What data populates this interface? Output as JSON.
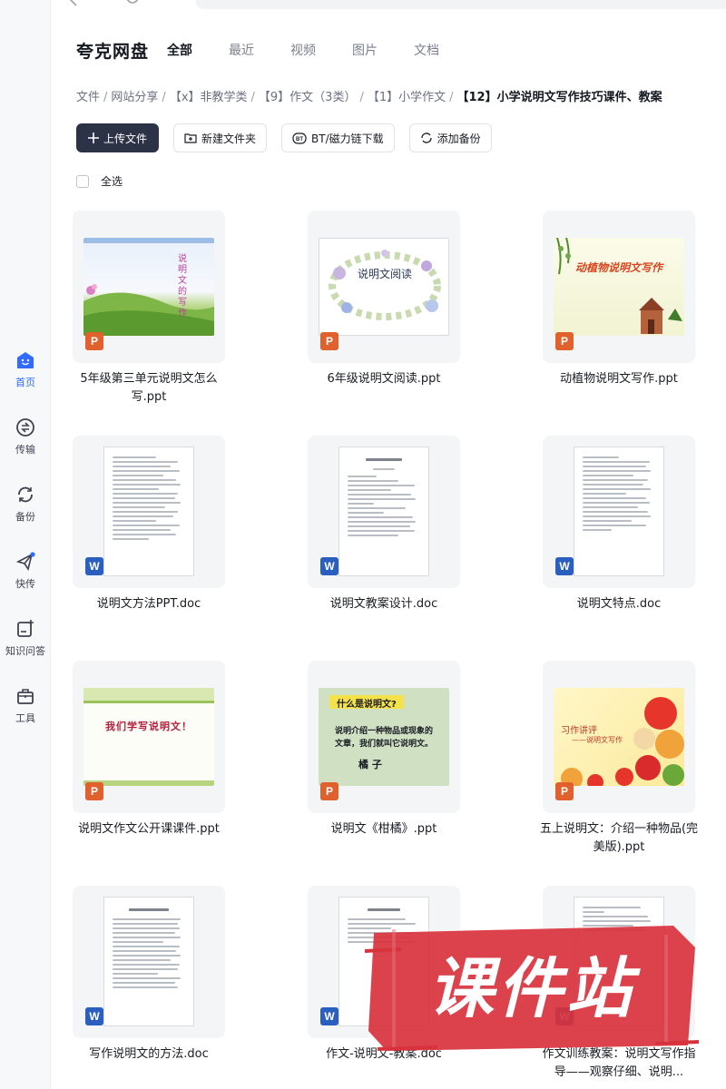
{
  "sidebar": {
    "items": [
      {
        "label": "首页",
        "icon": "home-icon",
        "active": true
      },
      {
        "label": "传输",
        "icon": "transfer-icon",
        "active": false
      },
      {
        "label": "备份",
        "icon": "backup-icon",
        "active": false
      },
      {
        "label": "快传",
        "icon": "quick-send-icon",
        "active": false
      },
      {
        "label": "知识问答",
        "icon": "qa-icon",
        "active": false
      },
      {
        "label": "工具",
        "icon": "toolbox-icon",
        "active": false
      }
    ]
  },
  "header": {
    "brand": "夸克网盘",
    "tabs": [
      "全部",
      "最近",
      "视频",
      "图片",
      "文档"
    ],
    "active_tab": "全部"
  },
  "breadcrumb": [
    "文件",
    "网站分享",
    "【x】非教学类",
    "【9】作文（3类）",
    "【1】小学作文",
    "【12】小学说明文写作技巧课件、教案"
  ],
  "toolbar": {
    "upload": "上传文件",
    "new_folder": "新建文件夹",
    "bt_download": "BT/磁力链下载",
    "add_backup": "添加备份"
  },
  "select_all": "全选",
  "files": [
    {
      "name": "5年级第三单元说明文怎么写.ppt",
      "type": "ppt",
      "thumb_text": "说明文的写作"
    },
    {
      "name": "6年级说明文阅读.ppt",
      "type": "ppt",
      "thumb_text": "说明文阅读"
    },
    {
      "name": "动植物说明文写作.ppt",
      "type": "ppt",
      "thumb_text": "动植物说明文写作"
    },
    {
      "name": "说明文方法PPT.doc",
      "type": "doc"
    },
    {
      "name": "说明文教案设计.doc",
      "type": "doc"
    },
    {
      "name": "说明文特点.doc",
      "type": "doc"
    },
    {
      "name": "说明文作文公开课课件.ppt",
      "type": "ppt",
      "thumb_text": "我们学写说明文！"
    },
    {
      "name": "说明文《柑橘》.ppt",
      "type": "ppt",
      "thumb_text": [
        "什么是说明文?",
        "说明介绍一种物品或现象的",
        "文章，我们就叫它说明文。",
        "橘  子"
      ]
    },
    {
      "name": "五上说明文：介绍一种物品(完美版).ppt",
      "type": "ppt",
      "thumb_text": [
        "习作讲评",
        "——说明文写作"
      ]
    },
    {
      "name": "写作说明文的方法.doc",
      "type": "doc"
    },
    {
      "name": "作文-说明文-教案.doc",
      "type": "doc"
    },
    {
      "name": "作文训练教案：说明文写作指导——观察仔细、说明...",
      "type": "doc"
    }
  ],
  "watermark": "课件站",
  "colors": {
    "accent": "#2f6bff",
    "primary_button": "#2c3347",
    "ppt_badge": "#e0612e",
    "doc_badge": "#2b5fbf",
    "watermark": "#d8323c"
  }
}
